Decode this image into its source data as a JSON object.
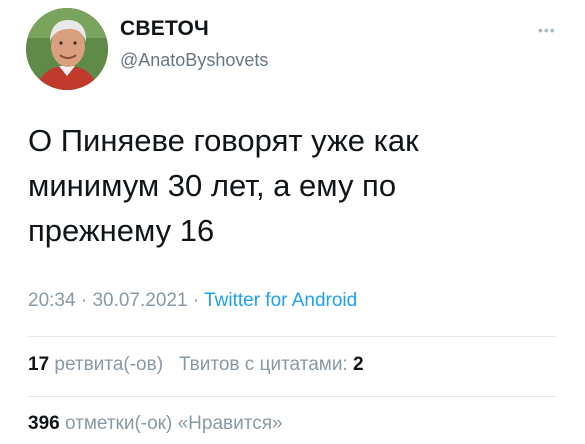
{
  "author": {
    "name": "СВЕТОЧ",
    "handle": "@AnatoByshovets",
    "more_icon": "more-dots-icon"
  },
  "tweet": {
    "text": "О Пиняеве говорят уже как\nминимум 30 лет, а ему по\nпрежнему 16",
    "time": "20:34",
    "separator": "·",
    "date": "30.07.2021",
    "source": "Twitter for Android"
  },
  "stats": {
    "retweets_count": "17",
    "retweets_label": "ретвита(-ов)",
    "quotes_label": "Твитов с цитатами:",
    "quotes_count": "2",
    "likes_count": "396",
    "likes_label": "отметки(-ок) «Нравится»"
  },
  "colors": {
    "text": "#0f1419",
    "secondary": "#657786",
    "link": "#1da1f2",
    "divider": "#e1e8ed"
  }
}
